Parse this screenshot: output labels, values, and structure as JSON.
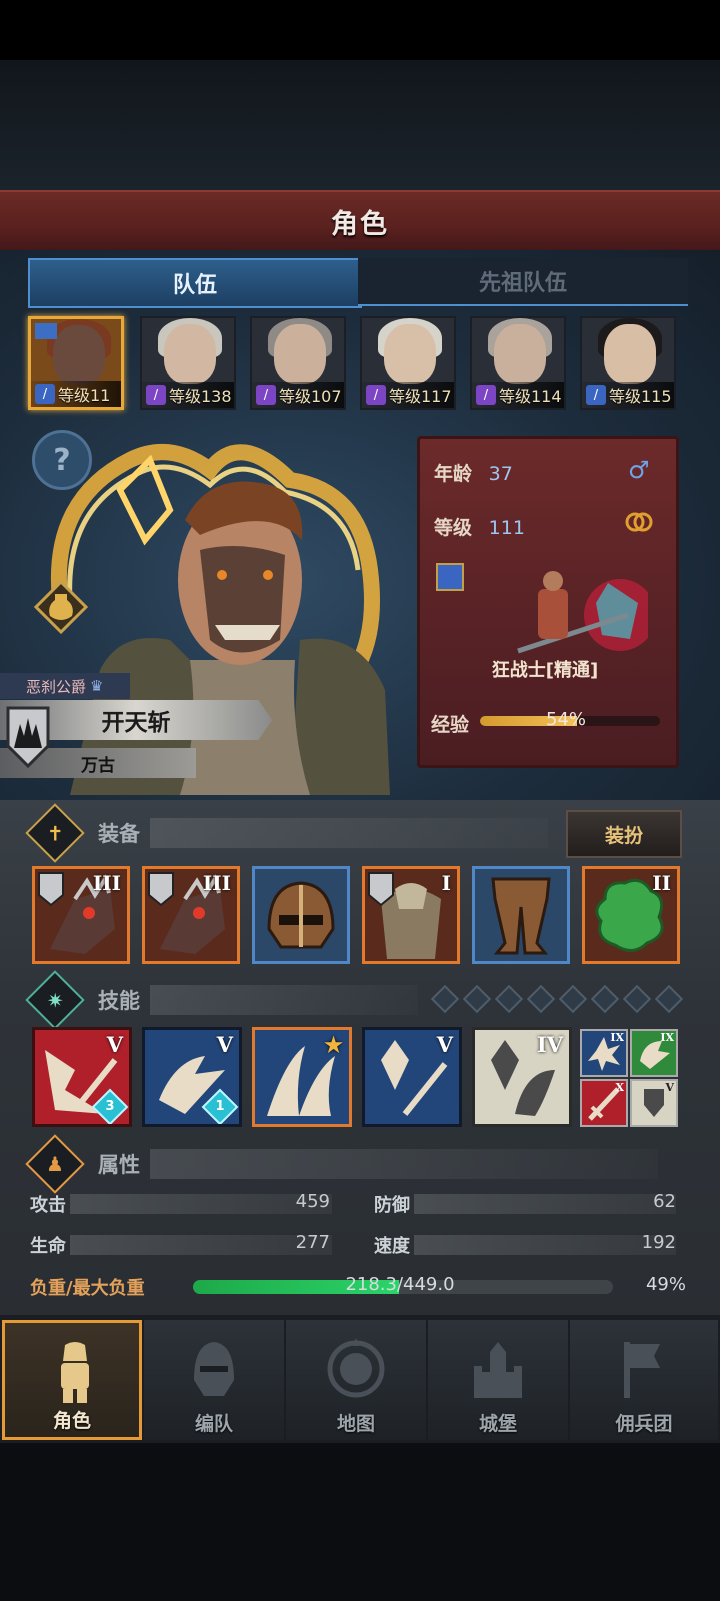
{
  "header": {
    "title": "角色"
  },
  "tabs": [
    {
      "label": "队伍",
      "active": true
    },
    {
      "label": "先祖队伍",
      "active": false
    }
  ],
  "heroes": [
    {
      "level": "等级11",
      "class_color": "#3a66c2",
      "selected": true
    },
    {
      "level": "等级138",
      "class_color": "#7b45c4",
      "selected": false
    },
    {
      "level": "等级107",
      "class_color": "#7b45c4",
      "selected": false
    },
    {
      "level": "等级117",
      "class_color": "#7b45c4",
      "selected": false
    },
    {
      "level": "等级114",
      "class_color": "#7b45c4",
      "selected": false
    },
    {
      "level": "等级115",
      "class_color": "#3a66c2",
      "selected": false
    }
  ],
  "character": {
    "title_tag": "恶刹公爵",
    "name": "开天斩",
    "subtitle": "万古",
    "age_label": "年龄",
    "age": "37",
    "gender_symbol": "♂",
    "level_label": "等级",
    "level": "111",
    "class_name": "狂战士[精通]",
    "exp_label": "经验",
    "exp_percent": "54%",
    "exp_fraction": 0.54
  },
  "equipment": {
    "label": "装备",
    "dress_button": "装扮",
    "items": [
      {
        "icon": "blade-gauntlet-icon",
        "tier": "III",
        "rarity": "orange"
      },
      {
        "icon": "blade-gauntlet-icon",
        "tier": "III",
        "rarity": "orange"
      },
      {
        "icon": "helmet-icon",
        "tier": "",
        "rarity": "blue"
      },
      {
        "icon": "fur-armor-icon",
        "tier": "I",
        "rarity": "orange"
      },
      {
        "icon": "leather-pants-icon",
        "tier": "",
        "rarity": "blue"
      },
      {
        "icon": "green-jade-icon",
        "tier": "II",
        "rarity": "orange"
      }
    ]
  },
  "skills": {
    "label": "技能",
    "slots_total": 8,
    "items": [
      {
        "icon": "slash-skill-icon",
        "tier": "V",
        "gem": "3",
        "bg": "#b0202a"
      },
      {
        "icon": "leap-skill-icon",
        "tier": "V",
        "gem": "1",
        "bg": "#23467a"
      },
      {
        "icon": "claw-skill-icon",
        "tier": "★",
        "gem": "",
        "bg": "#23467a"
      },
      {
        "icon": "crystal-sword-icon",
        "tier": "V",
        "gem": "",
        "bg": "#23467a"
      },
      {
        "icon": "crystal-arm-icon",
        "tier": "IV",
        "gem": "",
        "bg": "#d8d4c4"
      }
    ],
    "passives": [
      {
        "icon": "burst-passive-icon",
        "tier": "IX",
        "bg": "#23467a"
      },
      {
        "icon": "roar-passive-icon",
        "tier": "IX",
        "bg": "#2f8a3c"
      },
      {
        "icon": "sword-passive-icon",
        "tier": "X",
        "bg": "#b0202a"
      },
      {
        "icon": "shield-passive-icon",
        "tier": "V",
        "bg": "#d8d4c4"
      }
    ]
  },
  "attributes": {
    "label": "属性",
    "attack_label": "攻击",
    "attack": "459",
    "defense_label": "防御",
    "defense": "62",
    "hp_label": "生命",
    "hp": "277",
    "speed_label": "速度",
    "speed": "192",
    "load_label": "负重/最大负重",
    "load": "218.3/449.0",
    "load_percent": "49%",
    "load_fraction": 0.49
  },
  "nav": [
    {
      "label": "角色",
      "icon": "knight-icon",
      "active": true
    },
    {
      "label": "编队",
      "icon": "helmet-icon",
      "active": false
    },
    {
      "label": "地图",
      "icon": "compass-icon",
      "active": false
    },
    {
      "label": "城堡",
      "icon": "castle-icon",
      "active": false
    },
    {
      "label": "佣兵团",
      "icon": "banner-icon",
      "active": false
    }
  ]
}
